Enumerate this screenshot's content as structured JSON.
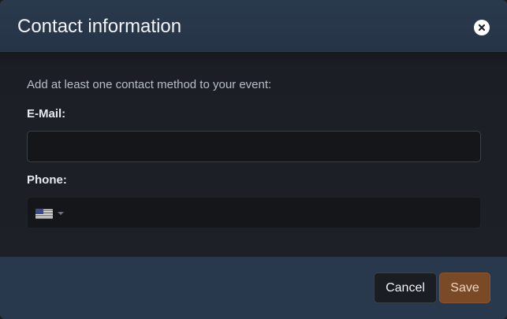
{
  "dialog": {
    "title": "Contact information",
    "close_icon": "close-icon"
  },
  "body": {
    "intro": "Add at least one contact method to your event:",
    "email": {
      "label": "E-Mail:",
      "value": "",
      "placeholder": ""
    },
    "phone": {
      "label": "Phone:",
      "country_flag": "us-flag-icon",
      "value": "",
      "placeholder": ""
    }
  },
  "footer": {
    "cancel_label": "Cancel",
    "save_label": "Save"
  },
  "colors": {
    "header_bg": "#253446",
    "footer_bg": "#28394d",
    "save_button_bg": "#7a4a27",
    "save_button_text": "#e9d7c6"
  }
}
